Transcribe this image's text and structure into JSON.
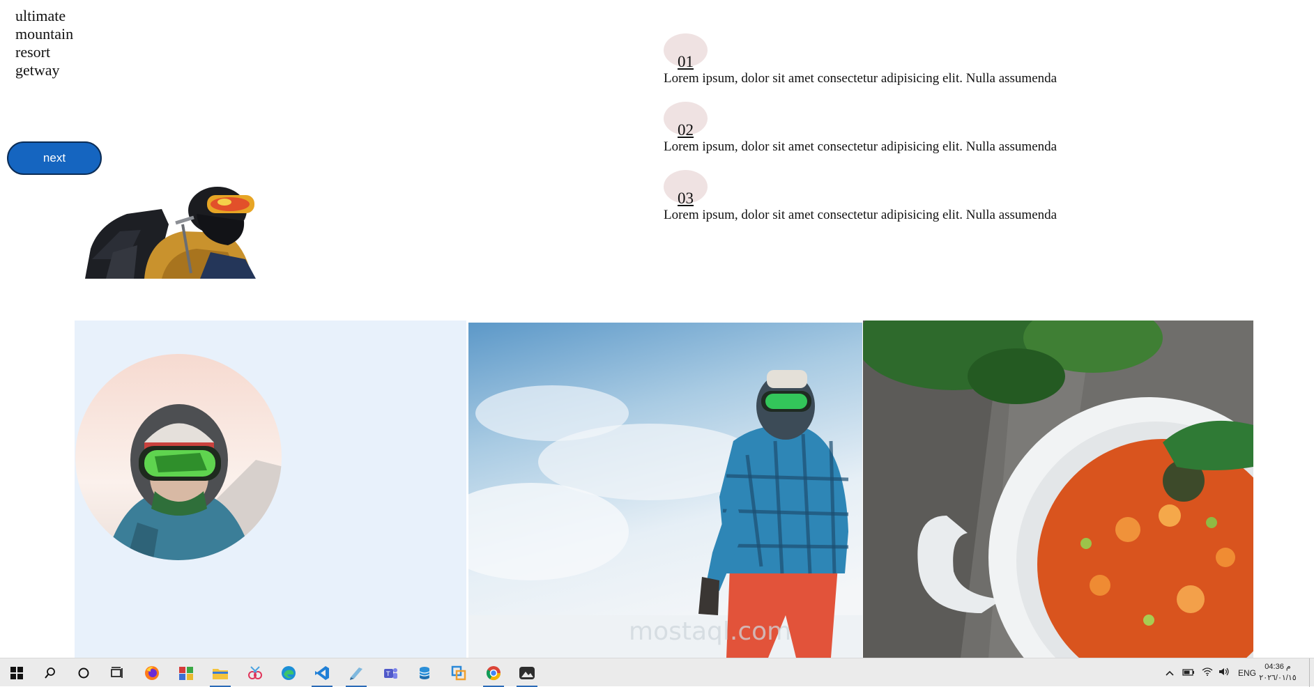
{
  "hero": {
    "title_lines": [
      "ultimate",
      "mountain",
      "resort",
      "getway"
    ],
    "next_label": "next"
  },
  "features": [
    {
      "number": "01",
      "text": "Lorem ipsum, dolor sit amet consectetur adipisicing elit. Nulla assumenda"
    },
    {
      "number": "02",
      "text": "Lorem ipsum, dolor sit amet consectetur adipisicing elit. Nulla assumenda"
    },
    {
      "number": "03",
      "text": "Lorem ipsum, dolor sit amet consectetur adipisicing elit. Nulla assumenda"
    }
  ],
  "gallery": {
    "images": [
      "skier-portrait-circle",
      "snowboarder-in-snow",
      "vegetable-soup-bowl"
    ]
  },
  "taskbar": {
    "apps": [
      "windows-start-icon",
      "search-icon",
      "cortana-icon",
      "task-view-icon",
      "firefox-icon",
      "winrar-icon",
      "file-explorer-icon",
      "snipping-tool-icon",
      "edge-icon",
      "vscode-icon",
      "notepad-icon",
      "teams-icon",
      "sql-icon",
      "virtualbox-icon",
      "chrome-icon",
      "photos-icon"
    ],
    "active_apps": [
      "file-explorer-icon",
      "vscode-icon",
      "notepad-icon",
      "chrome-icon",
      "photos-icon"
    ],
    "language": "ENG",
    "time": "04:36 م",
    "date": "٢٠٢٦/٠١/١٥"
  },
  "colors": {
    "accent": "#1565c0",
    "feature_circle": "#efe2e2",
    "panel_bg": "#e8f1fb"
  }
}
